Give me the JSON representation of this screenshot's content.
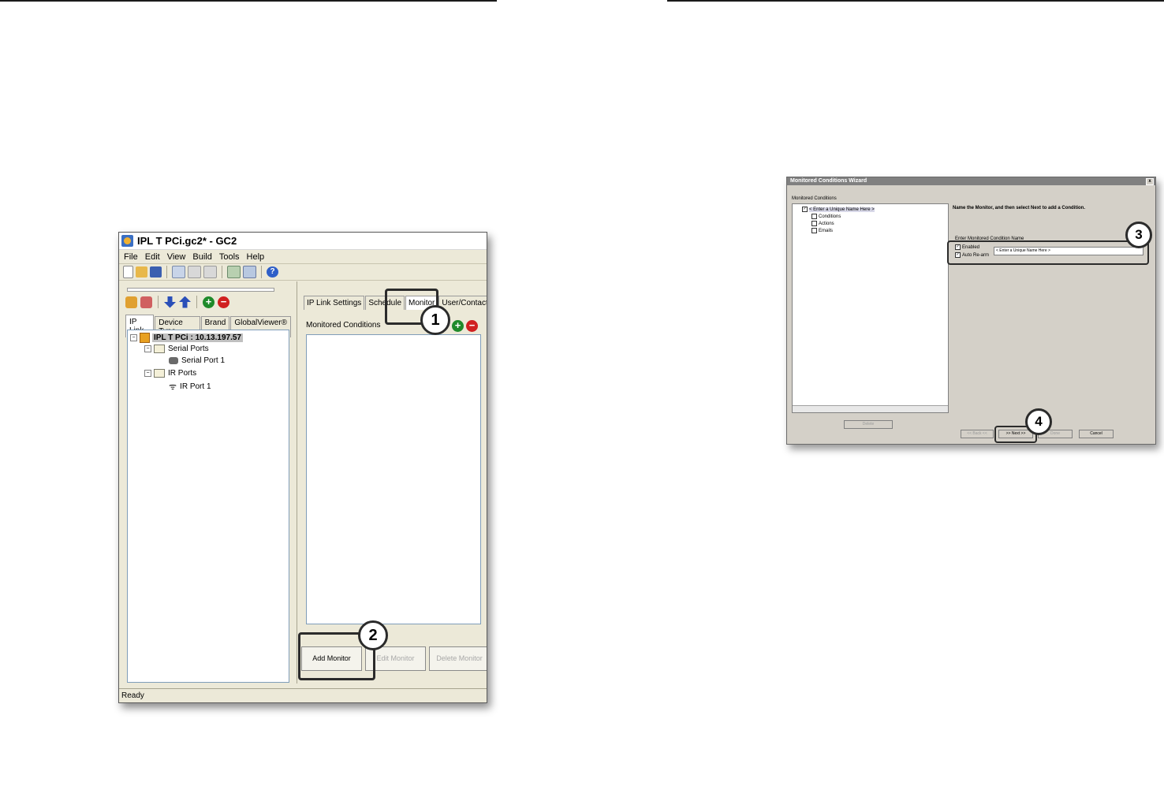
{
  "gc2": {
    "title": "IPL T PCi.gc2* - GC2",
    "menu": [
      "File",
      "Edit",
      "View",
      "Build",
      "Tools",
      "Help"
    ],
    "left_tabs": [
      "IP Link",
      "Device Type",
      "Brand",
      "GlobalViewer®"
    ],
    "tree": {
      "root": "IPL T PCi : 10.13.197.57",
      "serial_ports": "Serial Ports",
      "serial_port_1": "Serial Port 1",
      "ir_ports": "IR Ports",
      "ir_port_1": "IR Port 1"
    },
    "right_tabs": [
      "IP Link Settings",
      "Schedule",
      "Monitor",
      "User/Contact I"
    ],
    "monitored_conditions_label": "Monitored Conditions",
    "buttons": {
      "add_monitor": "Add Monitor",
      "edit_monitor": "Edit Monitor",
      "delete_monitor": "Delete Monitor"
    },
    "status": "Ready"
  },
  "wizard": {
    "title": "Monitored Conditions Wizard",
    "close": "x",
    "list_label": "Monitored Conditions",
    "tree": {
      "root": "< Enter a Unique Name Here >",
      "conditions": "Conditions",
      "actions": "Actions",
      "emails": "Emails"
    },
    "instruction": "Name the Monitor, and then select Next to add a Condition.",
    "name_group_label": "Enter Monitored Condition Name",
    "enabled_label": "Enabled",
    "auto_rearm_label": "Auto Re-arm",
    "name_input_value": "< Enter a Unique Name Here >",
    "buttons": {
      "delete": "Delete",
      "back": "<< Back <<",
      "next": ">> Next >>",
      "done": "Done",
      "cancel": "Cancel"
    }
  },
  "callouts": [
    "1",
    "2",
    "3",
    "4"
  ],
  "colors": {
    "highlight": "#2b2b2b",
    "tree_border": "#7f9db9",
    "dialog_bg": "#d4d0c8",
    "window_bg": "#ece9d8"
  }
}
